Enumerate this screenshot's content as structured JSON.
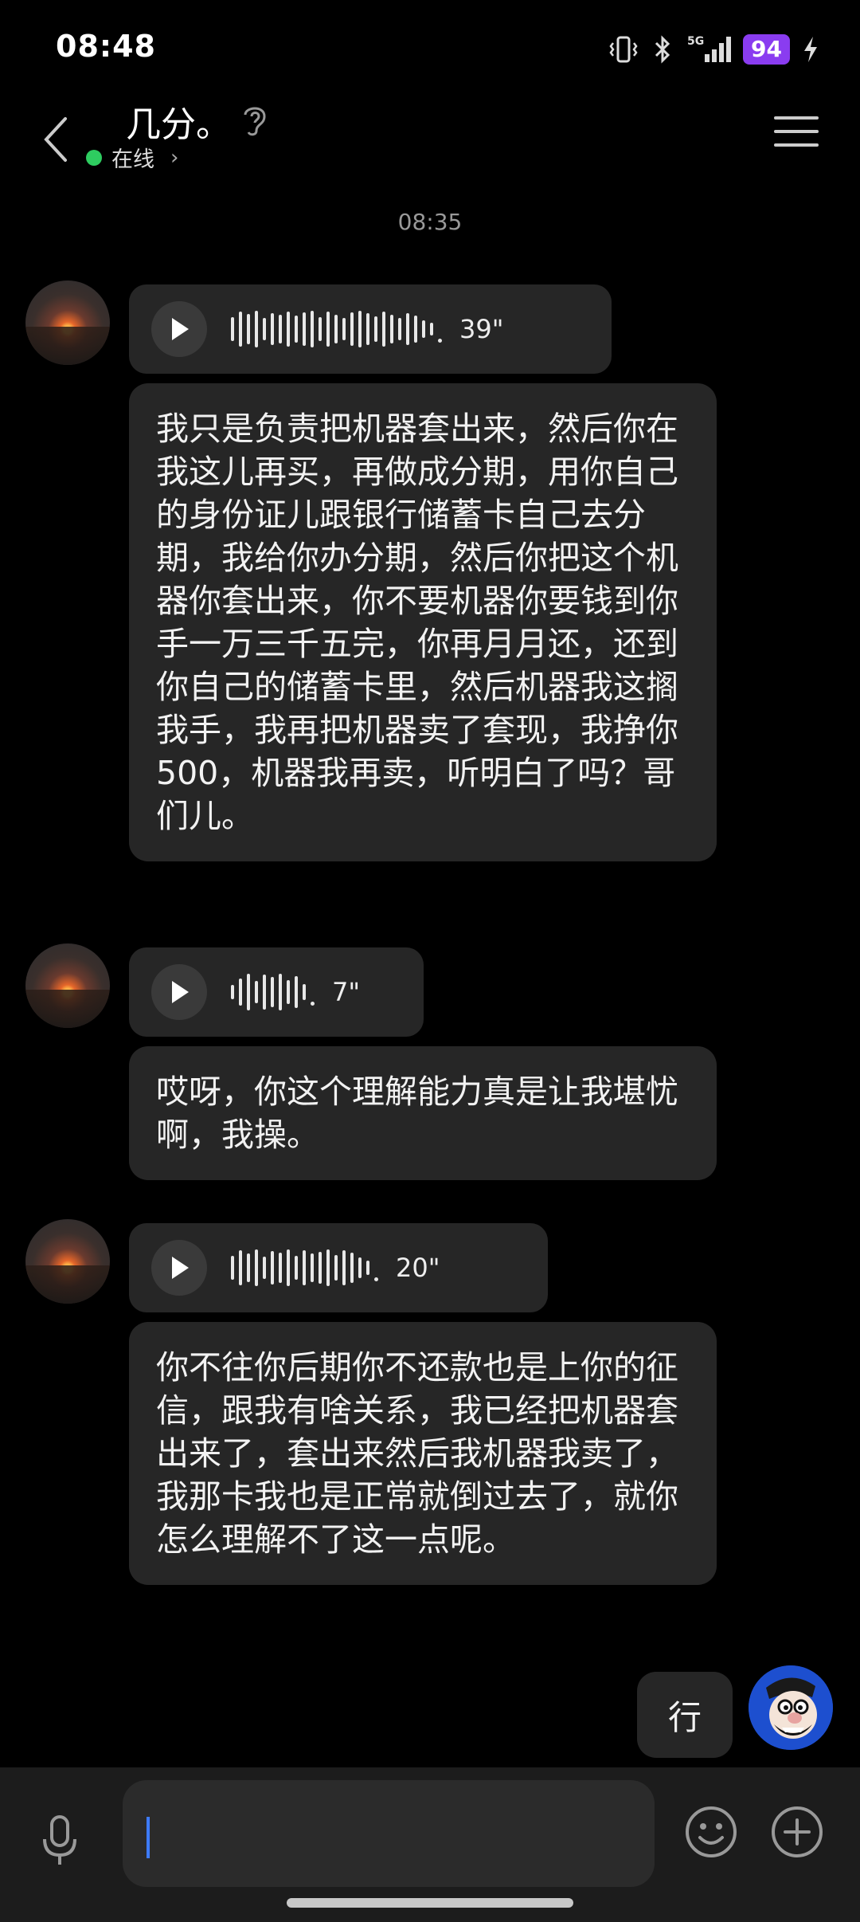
{
  "status_bar": {
    "time": "08:48",
    "network": "5G",
    "battery": "94"
  },
  "header": {
    "contact_name": "几分。",
    "online_status": "在线",
    "online_color": "#2ecc60"
  },
  "chat": {
    "timestamp": "08:35",
    "messages": [
      {
        "type": "voice",
        "duration": "39\""
      },
      {
        "type": "text",
        "text": "我只是负责把机器套出来，然后你在我这儿再买，再做成分期，用你自己的身份证儿跟银行储蓄卡自己去分期，我给你办分期，然后你把这个机器你套出来，你不要机器你要钱到你手一万三千五完，你再月月还，还到你自己的储蓄卡里，然后机器我这搁我手，我再把机器卖了套现，我挣你500，机器我再卖，听明白了吗？哥们儿。"
      },
      {
        "type": "voice",
        "duration": "7\""
      },
      {
        "type": "text",
        "text": "哎呀，你这个理解能力真是让我堪忧啊，我操。"
      },
      {
        "type": "voice",
        "duration": "20\""
      },
      {
        "type": "text",
        "text": "你不往你后期你不还款也是上你的征信，跟我有啥关系，我已经把机器套出来了，套出来然后我机器我卖了，我那卡我也是正常就倒过去了，就你怎么理解不了这一点呢。"
      },
      {
        "type": "text",
        "from": "me",
        "text": "行"
      }
    ]
  },
  "input": {
    "value": ""
  },
  "colors": {
    "background": "#000000",
    "bubble": "#262626",
    "battery_badge": "#8a3cf0",
    "caret": "#3d7bff"
  }
}
